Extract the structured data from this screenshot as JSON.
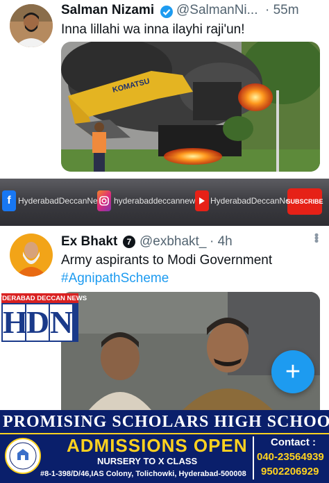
{
  "tweet1": {
    "name": "Salman Nizami",
    "handle": "@SalmanNi...",
    "time": "· 55m",
    "text": "Inna lillahi wa inna ilayhi raji'un!",
    "image_brand": "KOMATSU"
  },
  "social_strip": {
    "facebook": "HyderabadDeccanNews",
    "instagram": "hyderabaddeccannews",
    "youtube": "HyderabadDeccanNews",
    "subscribe": "SUBSCRIBE"
  },
  "tweet2": {
    "name": "Ex Bhakt",
    "badge": "7",
    "handle": "@exbhakt_",
    "time": "· 4h",
    "text": "Army aspirants to Modi Government",
    "hashtag": "#AgnipathScheme"
  },
  "hdn_logo": {
    "top": "HYDERABAD DECCAN NEWS",
    "letters": [
      "H",
      "D",
      "N"
    ]
  },
  "fab": {
    "label": "+"
  },
  "ad": {
    "school": "PROMISING SCHOLARS HIGH SCHOOL",
    "admissions": "ADMISSIONS OPEN",
    "classes": "NURSERY TO X CLASS",
    "address": "#8-1-398/D/46,IAS Colony, Tolichowki, Hyderabad-500008",
    "contact_label": "Contact :",
    "phones": [
      "040-23564939",
      "9502206929"
    ],
    "logo_text": "PROMISING SCHOLARS HIGH SCHOOL"
  },
  "colors": {
    "link": "#1d9bf0",
    "verified": "#1d9bf0",
    "ad_bg": "#0a1f6b",
    "ad_yellow": "#ffd21f",
    "hdn_red": "#d92121",
    "hdn_blue": "#1a3a8a"
  },
  "icons": [
    "verified-badge-icon",
    "more-options-icon",
    "facebook-icon",
    "instagram-icon",
    "youtube-icon",
    "compose-plus-icon"
  ]
}
